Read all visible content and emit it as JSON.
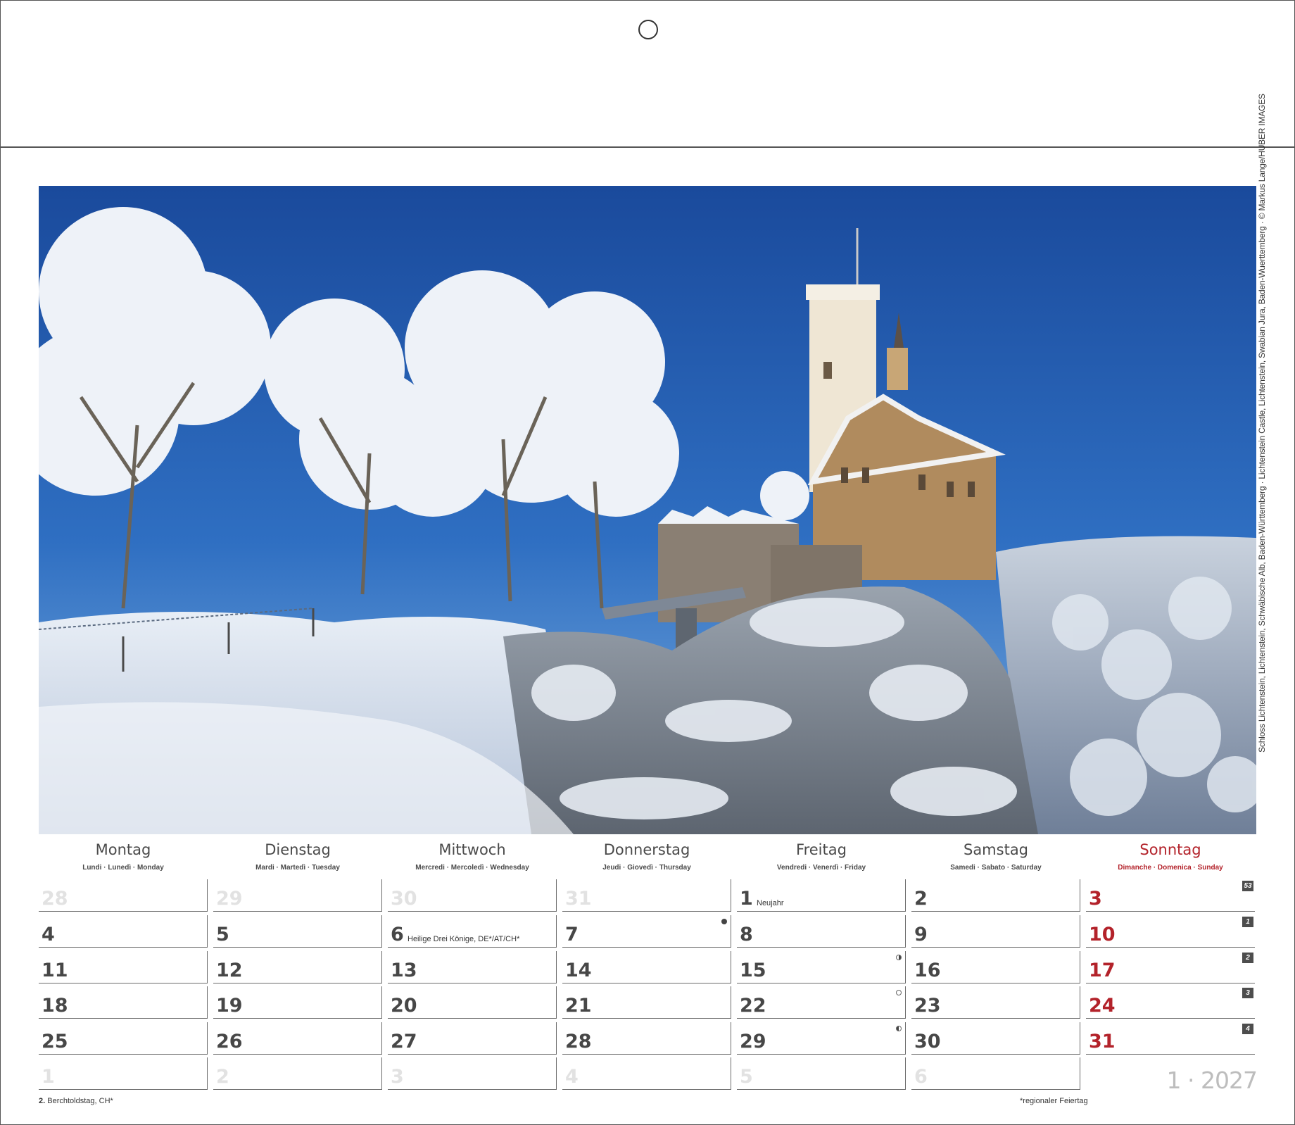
{
  "photo": {
    "credit": "Schloss Lichtenstein, Lichtenstein, Schwäbische Alb, Baden-Württemberg · Lichtenstein Castle, Lichtenstein, Swabian Jura, Baden-Wuerttemberg · © Markus Lange/HUBER IMAGES"
  },
  "weekdays": [
    {
      "name": "Montag",
      "sub": "Lundi · Lunedì · Monday"
    },
    {
      "name": "Dienstag",
      "sub": "Mardi · Martedì · Tuesday"
    },
    {
      "name": "Mittwoch",
      "sub": "Mercredi · Mercoledì · Wednesday"
    },
    {
      "name": "Donnerstag",
      "sub": "Jeudi · Giovedì · Thursday"
    },
    {
      "name": "Freitag",
      "sub": "Vendredi · Venerdì · Friday"
    },
    {
      "name": "Samstag",
      "sub": "Samedi · Sabato · Saturday"
    },
    {
      "name": "Sonntag",
      "sub": "Dimanche · Domenica · Sunday"
    }
  ],
  "weeks": [
    {
      "week": "53",
      "days": [
        {
          "n": "28",
          "dim": true
        },
        {
          "n": "29",
          "dim": true
        },
        {
          "n": "30",
          "dim": true
        },
        {
          "n": "31",
          "dim": true
        },
        {
          "n": "1",
          "holiday": "Neujahr"
        },
        {
          "n": "2"
        },
        {
          "n": "3"
        }
      ]
    },
    {
      "week": "1",
      "days": [
        {
          "n": "4"
        },
        {
          "n": "5"
        },
        {
          "n": "6",
          "holiday": "Heilige Drei Könige, DE*/AT/CH*"
        },
        {
          "n": "7",
          "moon": "new"
        },
        {
          "n": "8"
        },
        {
          "n": "9"
        },
        {
          "n": "10"
        }
      ]
    },
    {
      "week": "2",
      "days": [
        {
          "n": "11"
        },
        {
          "n": "12"
        },
        {
          "n": "13"
        },
        {
          "n": "14"
        },
        {
          "n": "15",
          "moon": "first"
        },
        {
          "n": "16"
        },
        {
          "n": "17"
        }
      ]
    },
    {
      "week": "3",
      "days": [
        {
          "n": "18"
        },
        {
          "n": "19"
        },
        {
          "n": "20"
        },
        {
          "n": "21"
        },
        {
          "n": "22",
          "moon": "full"
        },
        {
          "n": "23"
        },
        {
          "n": "24"
        }
      ]
    },
    {
      "week": "4",
      "days": [
        {
          "n": "25"
        },
        {
          "n": "26"
        },
        {
          "n": "27"
        },
        {
          "n": "28"
        },
        {
          "n": "29",
          "moon": "last"
        },
        {
          "n": "30"
        },
        {
          "n": "31"
        }
      ]
    },
    {
      "week": "",
      "days": [
        {
          "n": "1",
          "dim": true
        },
        {
          "n": "2",
          "dim": true
        },
        {
          "n": "3",
          "dim": true
        },
        {
          "n": "4",
          "dim": true
        },
        {
          "n": "5",
          "dim": true
        },
        {
          "n": "6",
          "dim": true
        }
      ]
    }
  ],
  "month_label": "1 · 2027",
  "footnote_left": {
    "day": "2.",
    "text": "Berchtoldstag, CH*"
  },
  "footnote_right": "*regionaler Feiertag",
  "colors": {
    "sunday": "#b3222a",
    "text": "#474747",
    "dim": "#e2e2e2",
    "sky": "#1e4fa0"
  }
}
